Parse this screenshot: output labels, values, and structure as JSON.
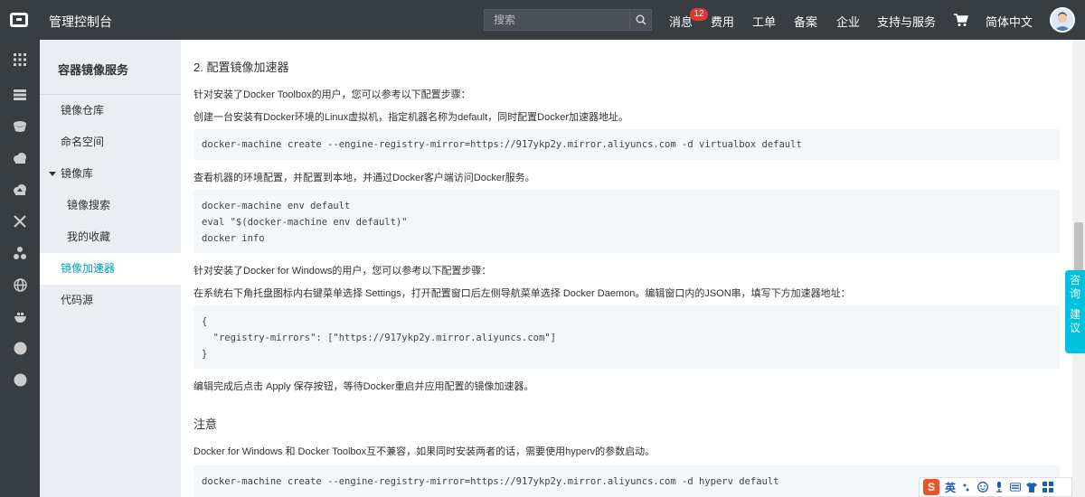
{
  "header": {
    "title": "管理控制台",
    "search_placeholder": "搜索",
    "nav": {
      "messages": "消息",
      "message_count": "12",
      "billing": "费用",
      "tickets": "工单",
      "record": "备案",
      "enterprise": "企业",
      "support": "支持与服务",
      "language": "简体中文"
    }
  },
  "sidebar": {
    "title": "容器镜像服务",
    "items": {
      "repos": "镜像仓库",
      "namespaces": "命名空间",
      "library": "镜像库",
      "search": "镜像搜索",
      "favorites": "我的收藏",
      "accelerator": "镜像加速器",
      "code_source": "代码源"
    }
  },
  "content": {
    "heading": "2. 配置镜像加速器",
    "p1": "针对安装了Docker Toolbox的用户，您可以参考以下配置步骤：",
    "p2": "创建一台安装有Docker环境的Linux虚拟机，指定机器名称为default，同时配置Docker加速器地址。",
    "code1": "docker-machine create --engine-registry-mirror=https://917ykp2y.mirror.aliyuncs.com -d virtualbox default",
    "p3": "查看机器的环境配置，并配置到本地，并通过Docker客户端访问Docker服务。",
    "code2": [
      "docker-machine env default",
      "eval \"$(docker-machine env default)\"",
      "docker info"
    ],
    "p4": "针对安装了Docker for Windows的用户，您可以参考以下配置步骤：",
    "p5": "在系统右下角托盘图标内右键菜单选择 Settings，打开配置窗口后左侧导航菜单选择 Docker Daemon。编辑窗口内的JSON串，填写下方加速器地址：",
    "code3": [
      "{",
      "  \"registry-mirrors\": [\"https://917ykp2y.mirror.aliyuncs.com\"]",
      "}"
    ],
    "p6": "编辑完成后点击 Apply 保存按钮，等待Docker重启并应用配置的镜像加速器。",
    "note_heading": "注意",
    "p7": "Docker for Windows 和 Docker Toolbox互不兼容，如果同时安装两者的话，需要使用hyperv的参数启动。",
    "code4": "docker-machine create --engine-registry-mirror=https://917ykp2y.mirror.aliyuncs.com -d hyperv default"
  },
  "consult": {
    "c1": "咨",
    "c2": "询",
    "c3": "·",
    "c4": "建",
    "c5": "议"
  },
  "ime": {
    "logo": "S",
    "mode": "英"
  },
  "colors": {
    "topbar": "#373d41",
    "sidebar": "#eaedf1",
    "accent": "#00a2ca",
    "code_bg": "#f4f7fa",
    "consult": "#00c1de",
    "badge": "#e03838"
  }
}
